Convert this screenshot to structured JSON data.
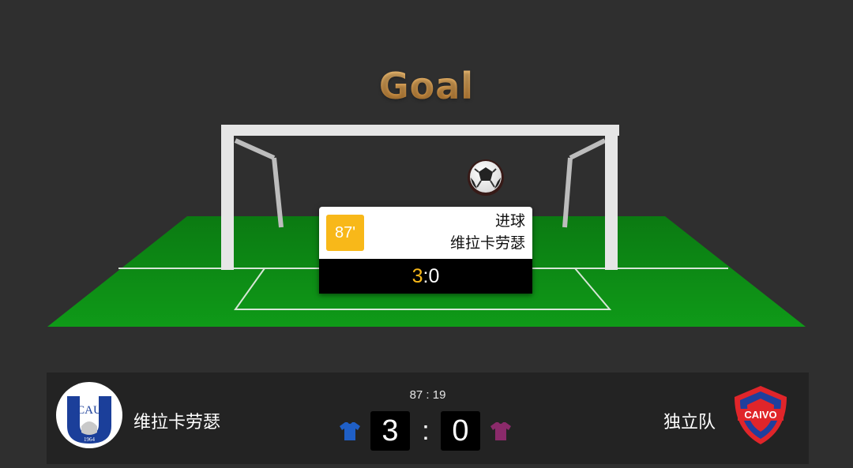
{
  "title": "Goal",
  "event": {
    "minute": "87'",
    "type": "进球",
    "team": "维拉卡劳瑟",
    "score_home": "3",
    "score_away": ":0"
  },
  "scoreboard": {
    "home": {
      "name": "维拉卡劳瑟",
      "logo_text": "CAU",
      "logo_year": "1964",
      "jersey_color": "#1f5fc6"
    },
    "away": {
      "name": "独立队",
      "logo_text": "CAIVO",
      "jersey_color": "#8a2a6a"
    },
    "clock": "87 : 19",
    "home_score": "3",
    "separator": ":",
    "away_score": "0"
  },
  "colors": {
    "background": "#2f2f2f",
    "pitch": "#0d8a15",
    "accent": "#f8b819",
    "bar": "#232323"
  },
  "icons": [
    "soccer-ball-icon",
    "home-jersey-icon",
    "away-jersey-icon"
  ]
}
